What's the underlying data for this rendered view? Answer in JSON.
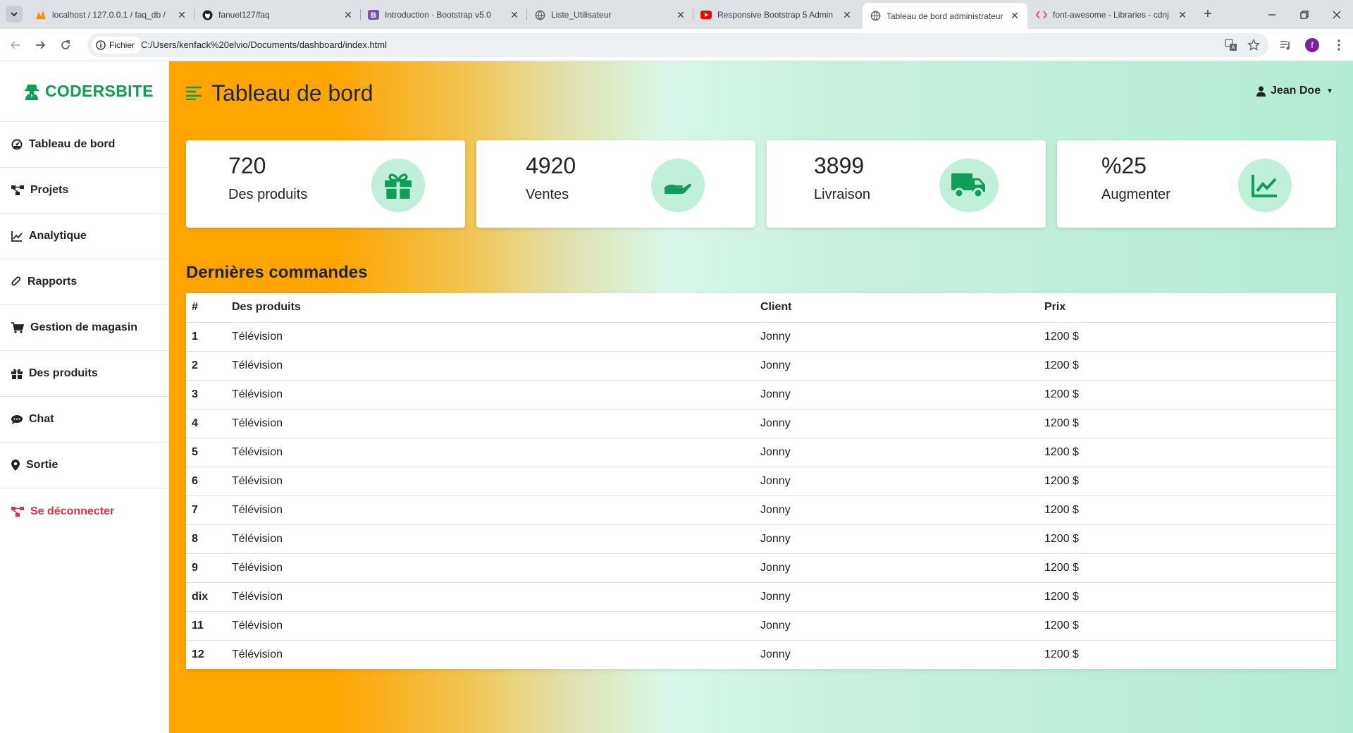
{
  "browser": {
    "tabs": [
      {
        "title": "localhost / 127.0.0.1 / faq_db /",
        "icon": "phpmyadmin-icon"
      },
      {
        "title": "fanuel127/faq",
        "icon": "github-icon"
      },
      {
        "title": "Introduction · Bootstrap v5.0",
        "icon": "bootstrap-icon"
      },
      {
        "title": "Liste_Utilisateur",
        "icon": "globe-icon"
      },
      {
        "title": "Responsive Bootstrap 5 Admin",
        "icon": "youtube-icon"
      },
      {
        "title": "Tableau de bord administrateur",
        "icon": "globe-icon",
        "active": true
      },
      {
        "title": "font-awesome - Libraries - cdnj",
        "icon": "code-icon"
      }
    ],
    "site_chip": "Fichier",
    "url": "C:/Users/kenfack%20elvio/Documents/dashboard/index.html",
    "profile_initial": "f"
  },
  "sidebar": {
    "brand": "CODERSBITE",
    "items": [
      {
        "label": "Tableau de bord",
        "icon": "tachometer-icon"
      },
      {
        "label": "Projets",
        "icon": "project-diagram-icon"
      },
      {
        "label": "Analytique",
        "icon": "chart-line-icon"
      },
      {
        "label": "Rapports",
        "icon": "paperclip-icon"
      },
      {
        "label": "Gestion de magasin",
        "icon": "shopping-cart-icon"
      },
      {
        "label": "Des produits",
        "icon": "gift-icon"
      },
      {
        "label": "Chat",
        "icon": "comment-dots-icon"
      },
      {
        "label": "Sortie",
        "icon": "map-marker-icon"
      },
      {
        "label": "Se déconnecter",
        "icon": "power-off-icon"
      }
    ]
  },
  "header": {
    "title": "Tableau de bord",
    "user": "Jean Doe"
  },
  "cards": [
    {
      "value": "720",
      "label": "Des produits",
      "icon": "gift-icon"
    },
    {
      "value": "4920",
      "label": "Ventes",
      "icon": "hand-holding-usd-icon"
    },
    {
      "value": "3899",
      "label": "Livraison",
      "icon": "truck-icon"
    },
    {
      "value": "%25",
      "label": "Augmenter",
      "icon": "chart-line-icon"
    }
  ],
  "orders": {
    "title": "Dernières commandes",
    "columns": [
      "#",
      "Des produits",
      "Client",
      "Prix"
    ],
    "rows": [
      [
        "1",
        "Télévision",
        "Jonny",
        "1200 $"
      ],
      [
        "2",
        "Télévision",
        "Jonny",
        "1200 $"
      ],
      [
        "3",
        "Télévision",
        "Jonny",
        "1200 $"
      ],
      [
        "4",
        "Télévision",
        "Jonny",
        "1200 $"
      ],
      [
        "5",
        "Télévision",
        "Jonny",
        "1200 $"
      ],
      [
        "6",
        "Télévision",
        "Jonny",
        "1200 $"
      ],
      [
        "7",
        "Télévision",
        "Jonny",
        "1200 $"
      ],
      [
        "8",
        "Télévision",
        "Jonny",
        "1200 $"
      ],
      [
        "9",
        "Télévision",
        "Jonny",
        "1200 $"
      ],
      [
        "dix",
        "Télévision",
        "Jonny",
        "1200 $"
      ],
      [
        "11",
        "Télévision",
        "Jonny",
        "1200 $"
      ],
      [
        "12",
        "Télévision",
        "Jonny",
        "1200 $"
      ]
    ]
  },
  "colors": {
    "brand_green": "#0f9d58",
    "icon_circle": "#c1f0da",
    "logout_red": "#dc3545",
    "gradient_orange": "#ffa500",
    "gradient_mint": "#b3ecd4"
  }
}
